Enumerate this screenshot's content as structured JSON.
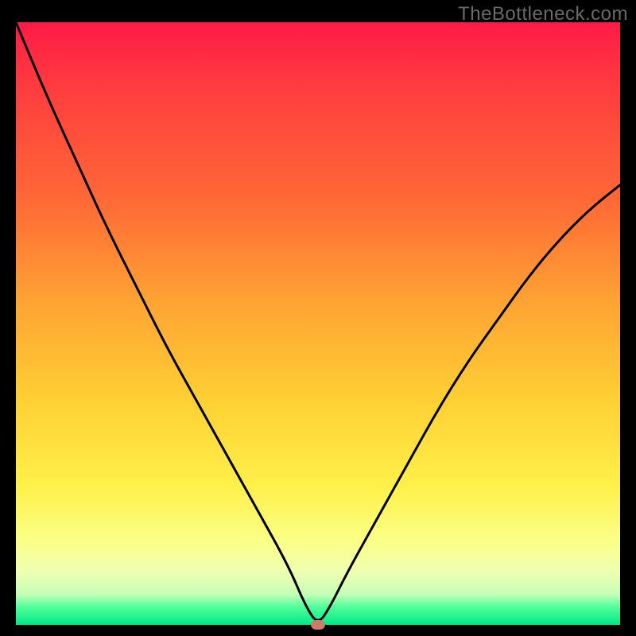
{
  "watermark": "TheBottleneck.com",
  "chart_data": {
    "type": "line",
    "title": "",
    "xlabel": "",
    "ylabel": "",
    "xlim": [
      0,
      100
    ],
    "ylim": [
      0,
      100
    ],
    "grid": false,
    "background_gradient": {
      "direction": "top-to-bottom",
      "stops": [
        {
          "pos": 0,
          "color": "#ff1a47"
        },
        {
          "pos": 30,
          "color": "#ff6a36"
        },
        {
          "pos": 62,
          "color": "#ffce33"
        },
        {
          "pos": 86,
          "color": "#fbff86"
        },
        {
          "pos": 97,
          "color": "#52ff9c"
        },
        {
          "pos": 100,
          "color": "#00e885"
        }
      ]
    },
    "series": [
      {
        "name": "bottleneck-curve",
        "color": "#000000",
        "x": [
          0,
          5,
          10,
          15,
          20,
          25,
          30,
          35,
          40,
          45,
          48,
          50,
          52,
          55,
          60,
          65,
          70,
          75,
          80,
          85,
          90,
          95,
          100
        ],
        "y": [
          100,
          88,
          77,
          66,
          56,
          46,
          37,
          28,
          19,
          10,
          3,
          0,
          3,
          9,
          18,
          27,
          36,
          44,
          51,
          58,
          64,
          69,
          73
        ]
      }
    ],
    "marker": {
      "name": "optimal-point",
      "x": 50,
      "y": 0,
      "color": "#cf7a65"
    }
  }
}
